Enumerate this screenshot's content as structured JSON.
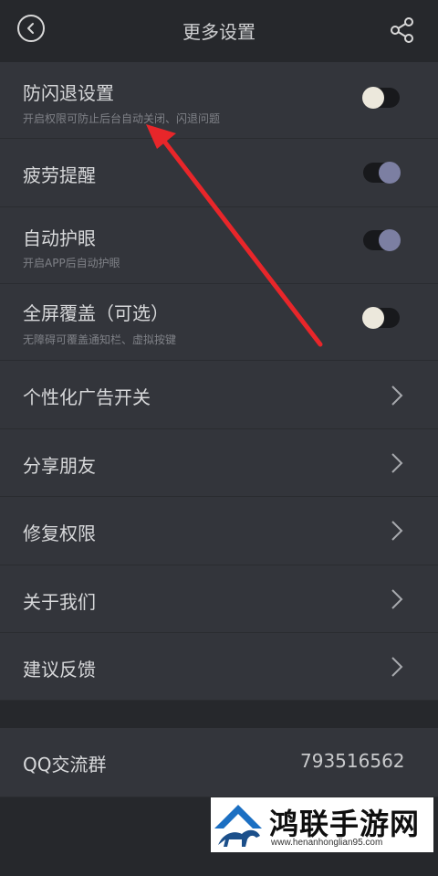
{
  "header": {
    "title": "更多设置",
    "back_icon": "back-icon",
    "share_icon": "share-icon"
  },
  "settings": {
    "anti_crash": {
      "label": "防闪退设置",
      "subtitle": "开启权限可防止后台自动关闭、闪退问题",
      "enabled": false
    },
    "fatigue_reminder": {
      "label": "疲劳提醒",
      "enabled": true
    },
    "auto_eye_care": {
      "label": "自动护眼",
      "subtitle": "开启APP后自动护眼",
      "enabled": true
    },
    "fullscreen_overlay": {
      "label": "全屏覆盖（可选）",
      "subtitle": "无障碍可覆盖通知栏、虚拟按键",
      "enabled": false
    }
  },
  "menu": {
    "ads": {
      "label": "个性化广告开关"
    },
    "share_friends": {
      "label": "分享朋友"
    },
    "repair_permissions": {
      "label": "修复权限"
    },
    "about_us": {
      "label": "关于我们"
    },
    "feedback": {
      "label": "建议反馈"
    }
  },
  "qq_group": {
    "label": "QQ交流群",
    "value": "793516562"
  },
  "colors": {
    "background": "#26282c",
    "row": "#33353b",
    "toggle_on_knob": "#7c7fa2",
    "toggle_off_knob": "#ece8dc",
    "annotation_arrow": "#e8262a"
  },
  "watermark": {
    "title": "鸿联手游网",
    "url": "www.henanhonglian95.com"
  }
}
